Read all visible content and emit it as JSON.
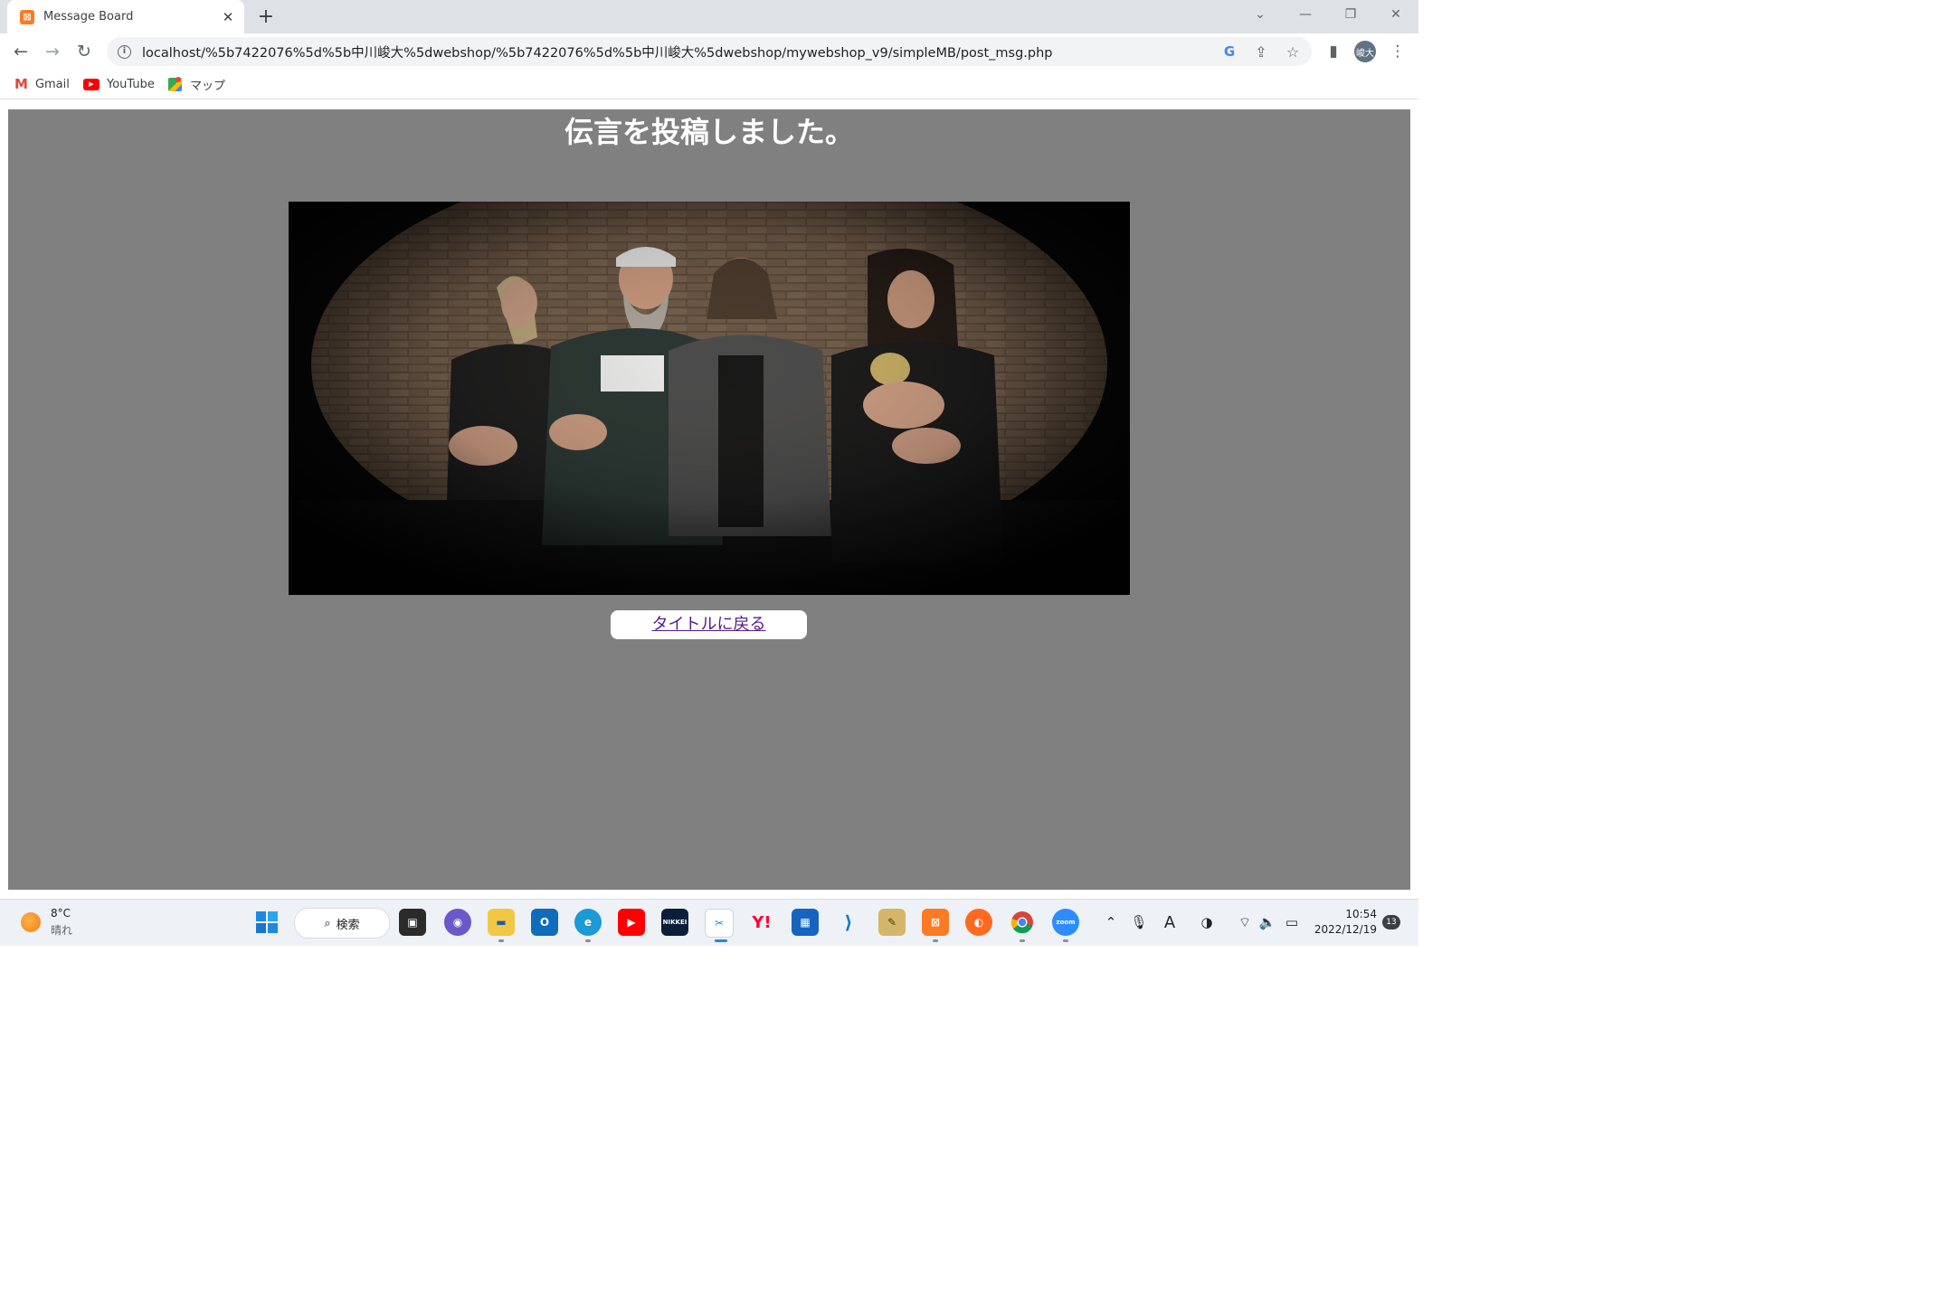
{
  "browser": {
    "tab_title": "Message Board",
    "url": "localhost/%5b7422076%5d%5b中川峻大%5dwebshop/%5b7422076%5d%5b中川峻大%5dwebshop/mywebshop_v9/simpleMB/post_msg.php",
    "profile_initials": "峻大",
    "bookmarks": [
      {
        "label": "Gmail"
      },
      {
        "label": "YouTube"
      },
      {
        "label": "マップ"
      }
    ]
  },
  "page": {
    "background": "#808080",
    "heading": "伝言を投稿しました。",
    "back_link": "タイトルに戻る",
    "link_color": "#551a8b"
  },
  "taskbar": {
    "temperature": "8°C",
    "weather": "晴れ",
    "search_label": "検索",
    "time": "10:54",
    "date": "2022/12/19",
    "notification_count": "13"
  }
}
